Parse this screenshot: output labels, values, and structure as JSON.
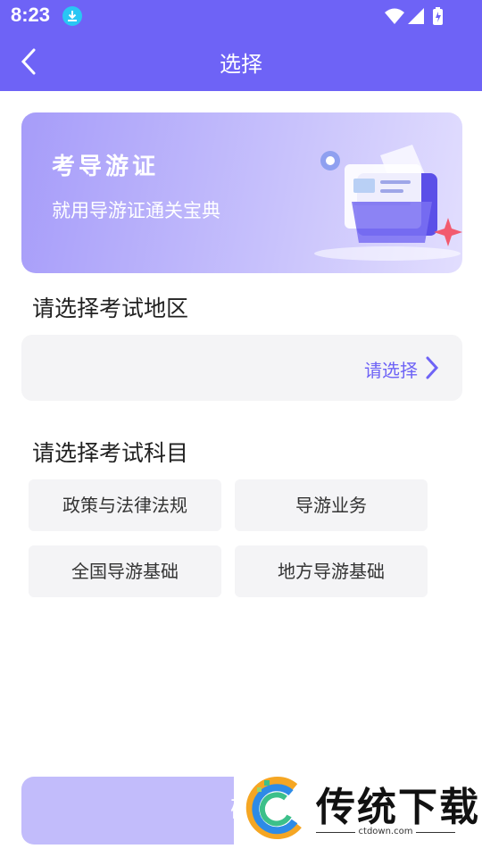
{
  "status_bar": {
    "time": "8:23"
  },
  "nav": {
    "title": "选择"
  },
  "banner": {
    "title": "考导游证",
    "subtitle": "就用导游证通关宝典"
  },
  "region": {
    "label": "请选择考试地区",
    "placeholder": "请选择"
  },
  "subject": {
    "label": "请选择考试科目",
    "options": [
      "政策与法律法规",
      "导游业务",
      "全国导游基础",
      "地方导游基础"
    ]
  },
  "confirm": {
    "label": "确"
  },
  "watermark": {
    "text": "传统下载",
    "url": "ctdown.com"
  },
  "colors": {
    "accent": "#6E63F6",
    "chip_bg": "#F4F4F6",
    "confirm_bg": "#C2BCFB"
  }
}
